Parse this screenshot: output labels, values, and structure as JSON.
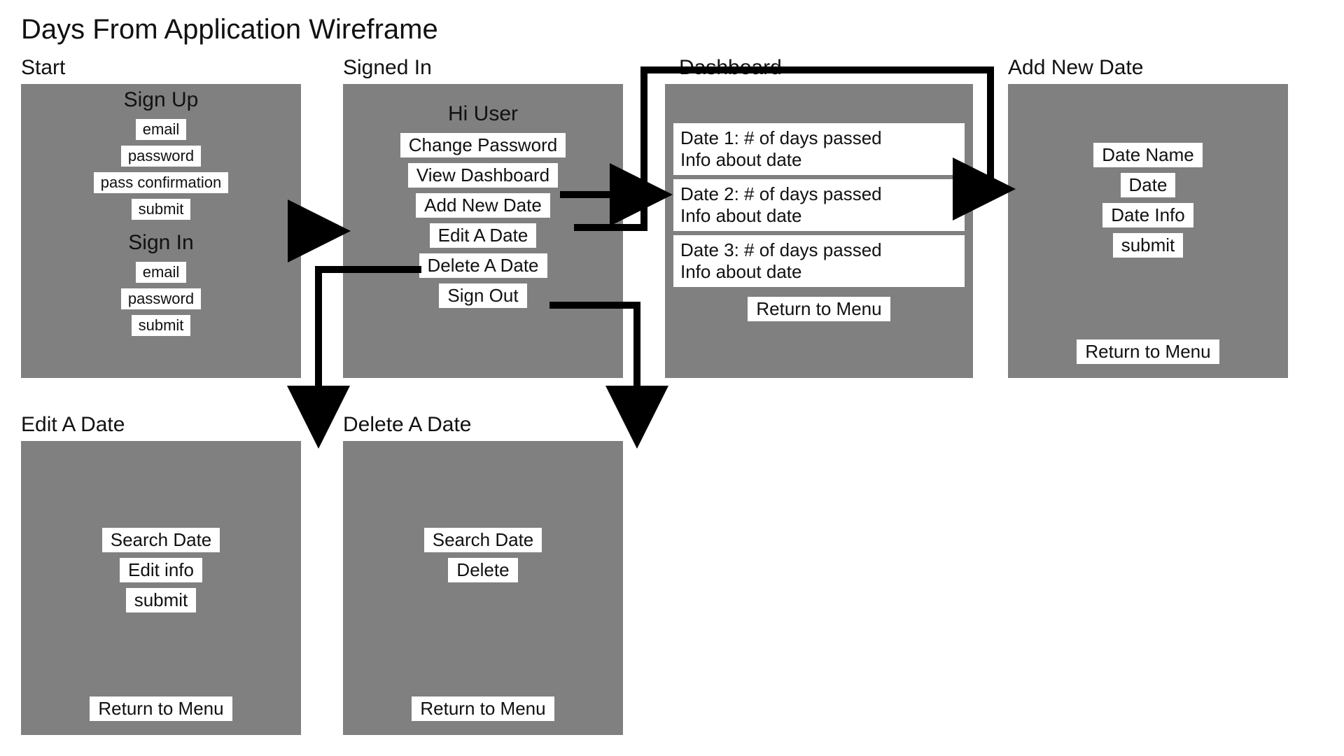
{
  "title": "Days From Application Wireframe",
  "start": {
    "label": "Start",
    "signup_heading": "Sign Up",
    "signup_email": "email",
    "signup_password": "password",
    "signup_pass_conf": "pass confirmation",
    "signup_submit": "submit",
    "signin_heading": "Sign In",
    "signin_email": "email",
    "signin_password": "password",
    "signin_submit": "submit"
  },
  "signed_in": {
    "label": "Signed In",
    "hi_user": "Hi User",
    "change_password": "Change Password",
    "view_dashboard": "View Dashboard",
    "add_new_date": "Add New Date",
    "edit_a_date": "Edit A Date",
    "delete_a_date": "Delete A Date",
    "sign_out": "Sign Out"
  },
  "dashboard": {
    "label": "Dashboard",
    "card1_line1": "Date 1: # of days passed",
    "card1_line2": "Info about date",
    "card2_line1": "Date 2: # of days passed",
    "card2_line2": "Info about date",
    "card3_line1": "Date 3: # of days passed",
    "card3_line2": "Info about date",
    "return": "Return to Menu"
  },
  "add_new_date": {
    "label": "Add New Date",
    "date_name": "Date Name",
    "date": "Date",
    "date_info": "Date Info",
    "submit": "submit",
    "return": "Return to Menu"
  },
  "edit_a_date": {
    "label": "Edit A Date",
    "search_date": "Search Date",
    "edit_info": "Edit info",
    "submit": "submit",
    "return": "Return to Menu"
  },
  "delete_a_date": {
    "label": "Delete A Date",
    "search_date": "Search Date",
    "delete": "Delete",
    "return": "Return to Menu"
  }
}
